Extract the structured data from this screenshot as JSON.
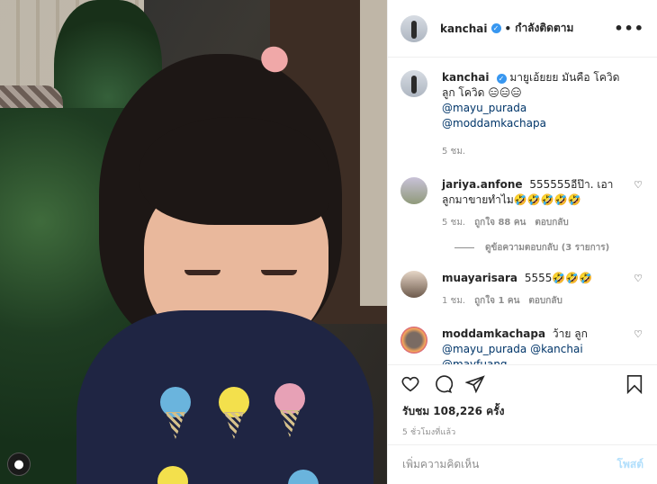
{
  "header": {
    "username": "kanchai",
    "separator": "•",
    "follow_label": "กำลังติดตาม",
    "more_icon": "more-dots-icon"
  },
  "comments": [
    {
      "user": "kanchai",
      "verified": true,
      "text": "มายูเอ้ยยย มันคือ โควิดลูก โควิด 😑😑😑",
      "mentions": [
        "@mayu_purada",
        "@moddamkachapa"
      ],
      "time": "5 ชม."
    },
    {
      "user": "jariya.anfone",
      "text": "555555อีป๊า. เอาลูกมาขายทำไม🤣🤣🤣🤣🤣",
      "time": "5 ชม.",
      "likes": "ถูกใจ 88 คน",
      "reply": "ตอบกลับ",
      "view_replies": "ดูข้อความตอบกลับ (3 รายการ)"
    },
    {
      "user": "muayarisara",
      "text": "5555🤣🤣🤣",
      "time": "1 ชม.",
      "likes": "ถูกใจ 1 คน",
      "reply": "ตอบกลับ"
    },
    {
      "user": "moddamkachapa",
      "text": "ว้าย ลูก",
      "mentions": [
        "@mayu_purada",
        "@kanchai",
        "@mayfuang"
      ]
    }
  ],
  "actions": {
    "like_icon": "heart-icon",
    "comment_icon": "comment-icon",
    "share_icon": "share-icon",
    "save_icon": "bookmark-icon"
  },
  "views": "รับชม 108,226 ครั้ง",
  "posted_ago": "5 ชั่วโมงที่แล้ว",
  "composer": {
    "placeholder": "เพิ่มความคิดเห็น",
    "post_label": "โพสต์"
  },
  "colors": {
    "mention": "#003569",
    "verified": "#3897f0",
    "meta": "#8e8e8e",
    "post_disabled": "#b2dffc"
  }
}
